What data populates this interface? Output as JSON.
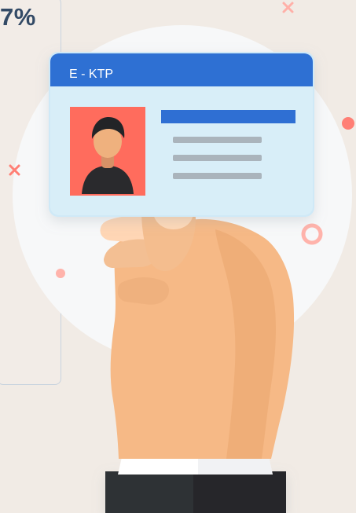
{
  "stat": {
    "percent_label": "7%"
  },
  "id_card": {
    "header_label": "E - KTP",
    "header_color": "#2f6fd3",
    "body_color": "#d8eef8",
    "accent_bar_color": "#2f6fd3",
    "photo_bg_color": "#ff6c5d"
  },
  "decorations": {
    "circle_color": "#f7f8f9",
    "accent_color": "#ff7f75"
  },
  "icons": {
    "cross_icon": "x-cross",
    "dot_icon": "filled-dot",
    "ring_icon": "ring"
  }
}
